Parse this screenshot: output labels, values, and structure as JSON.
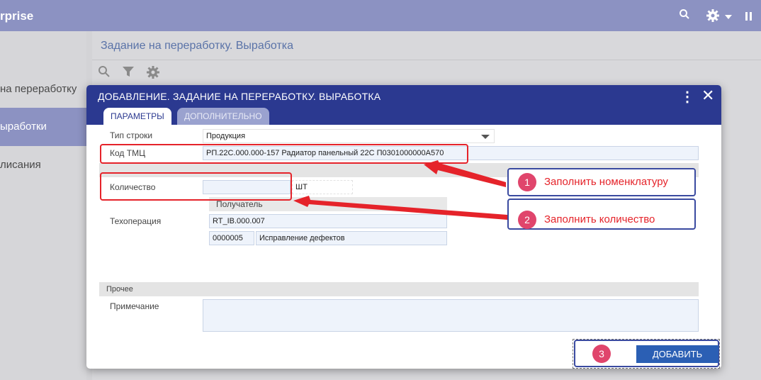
{
  "app": {
    "brand": "rprise"
  },
  "topbar_icons": [
    "search-icon",
    "gear-icon",
    "chevron-down-icon",
    "pause-icon"
  ],
  "nav": {
    "items": [
      {
        "label": "на переработку"
      },
      {
        "label": "ыработки"
      },
      {
        "label": "лисания"
      }
    ]
  },
  "page": {
    "title": "Задание на переработку. Выработка"
  },
  "dialog": {
    "title": "ДОБАВЛЕНИЕ. ЗАДАНИЕ НА ПЕРЕРАБОТКУ. ВЫРАБОТКА",
    "tabs": [
      "ПАРАМЕТРЫ",
      "ДОПОЛНИТЕЛЬНО"
    ],
    "fields": {
      "row_type_label": "Тип строки",
      "row_type_value": "Продукция",
      "tmc_label": "Код ТМЦ",
      "tmc_value": "РП.22С.000.000-157 Радиатор панельный 22С П0301000000А570",
      "qty_label": "Количество",
      "qty_value": "",
      "qty_unit": "ШТ",
      "recipient_header": "Получатель",
      "operation_label": "Техоперация",
      "operation_value": "RT_IB.000.007",
      "op_code": "0000005",
      "op_name": "Исправление дефектов",
      "other_section": "Прочее",
      "note_label": "Примечание",
      "note_value": ""
    },
    "add_button": "ДОБАВИТЬ"
  },
  "annotations": [
    {
      "num": "1",
      "text": "Заполнить номенклатуру"
    },
    {
      "num": "2",
      "text": "Заполнить количество"
    },
    {
      "num": "3",
      "text": ""
    }
  ],
  "colors": {
    "header": "#2b3990",
    "accent_red": "#e5232a",
    "badge": "#e0456c",
    "button": "#2b5fb4"
  }
}
